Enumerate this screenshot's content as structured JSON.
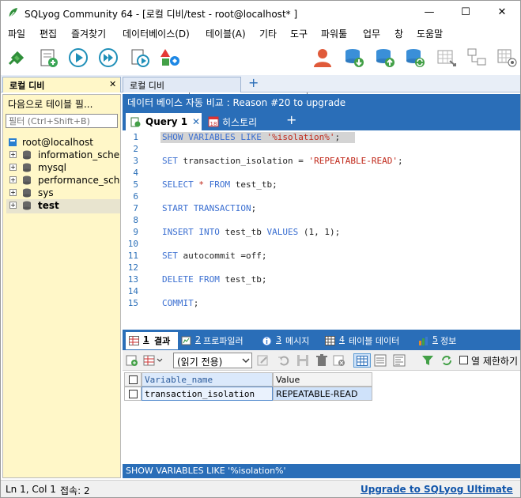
{
  "window": {
    "title": "SQLyog Community 64 - [로컬 디비/test - root@localhost* ]",
    "minimize": "—",
    "maximize": "☐",
    "close": "✕"
  },
  "menu": [
    "파일",
    "편집",
    "즐겨찾기",
    "데이터베이스(D)",
    "테이블(A)",
    "기타",
    "도구",
    "파워툴",
    "업무",
    "창",
    "도움말"
  ],
  "toolbar": {
    "database_select": "test"
  },
  "connection_tabs": [
    {
      "label": "로컬 디비",
      "close": "✕",
      "active": true
    },
    {
      "label": "로컬 디비",
      "active": false
    }
  ],
  "add_tab": "+",
  "object_browser": {
    "header": "다음으로 테이블 필...",
    "filter_placeholder": "필터 (Ctrl+Shift+B)",
    "root": "root@localhost",
    "databases": [
      {
        "name": "information_schema",
        "bold": false
      },
      {
        "name": "mysql",
        "bold": false
      },
      {
        "name": "performance_schema",
        "bold": false
      },
      {
        "name": "sys",
        "bold": false
      },
      {
        "name": "test",
        "bold": true
      }
    ]
  },
  "notice": "데이터 베이스 자동 비교 : Reason #20 to upgrade",
  "query_tabs": [
    {
      "label": "Query 1",
      "close": "✕",
      "active": true
    },
    {
      "label": "히스토리",
      "active": false
    }
  ],
  "add_query_tab": "+",
  "editor": {
    "lines": [
      {
        "num": "1",
        "parts": [
          {
            "t": "SHOW VARIABLES LIKE ",
            "c": "kw"
          },
          {
            "t": "'%isolation%'",
            "c": "str"
          },
          {
            "t": ";",
            "c": "plain"
          }
        ]
      },
      {
        "num": "2",
        "parts": []
      },
      {
        "num": "3",
        "parts": [
          {
            "t": "SET ",
            "c": "kw"
          },
          {
            "t": "transaction_isolation = ",
            "c": "plain"
          },
          {
            "t": "'REPEATABLE-READ'",
            "c": "str"
          },
          {
            "t": ";",
            "c": "plain"
          }
        ]
      },
      {
        "num": "4",
        "parts": []
      },
      {
        "num": "5",
        "parts": [
          {
            "t": "SELECT ",
            "c": "kw"
          },
          {
            "t": "* ",
            "c": "str"
          },
          {
            "t": "FROM ",
            "c": "kw"
          },
          {
            "t": "test_tb;",
            "c": "plain"
          }
        ]
      },
      {
        "num": "6",
        "parts": []
      },
      {
        "num": "7",
        "parts": [
          {
            "t": "START TRANSACTION",
            "c": "kw"
          },
          {
            "t": ";",
            "c": "plain"
          }
        ]
      },
      {
        "num": "8",
        "parts": []
      },
      {
        "num": "9",
        "parts": [
          {
            "t": "INSERT INTO ",
            "c": "kw"
          },
          {
            "t": "test_tb ",
            "c": "plain"
          },
          {
            "t": "VALUES ",
            "c": "kw"
          },
          {
            "t": "(1, 1);",
            "c": "plain"
          }
        ]
      },
      {
        "num": "10",
        "parts": []
      },
      {
        "num": "11",
        "parts": [
          {
            "t": "SET ",
            "c": "kw"
          },
          {
            "t": "autocommit =off;",
            "c": "plain"
          }
        ]
      },
      {
        "num": "12",
        "parts": []
      },
      {
        "num": "13",
        "parts": [
          {
            "t": "DELETE FROM ",
            "c": "kw"
          },
          {
            "t": "test_tb;",
            "c": "plain"
          }
        ]
      },
      {
        "num": "14",
        "parts": []
      },
      {
        "num": "15",
        "parts": [
          {
            "t": "COMMIT",
            "c": "kw"
          },
          {
            "t": ";",
            "c": "plain"
          }
        ]
      }
    ]
  },
  "result_tabs": [
    {
      "num": "1",
      "label": "결과",
      "active": true
    },
    {
      "num": "2",
      "label": "프로파일러"
    },
    {
      "num": "3",
      "label": "메시지"
    },
    {
      "num": "4",
      "label": "테이블 데이터"
    },
    {
      "num": "5",
      "label": "정보"
    }
  ],
  "result_toolbar": {
    "mode": "(읽기 전용)",
    "limit_label": "열 제한하기"
  },
  "grid": {
    "columns": [
      "Variable_name",
      "Value"
    ],
    "rows": [
      [
        "transaction_isolation",
        "REPEATABLE-READ"
      ]
    ]
  },
  "sql_status": "SHOW VARIABLES LIKE '%isolation%'",
  "status": {
    "position": "Ln 1, Col 1",
    "connections": "접속: 2",
    "upgrade_link": "Upgrade to SQLyog Ultimate"
  },
  "colors": {
    "accent_blue": "#2a6eb8",
    "browser_bg": "#fff7c8",
    "keyword": "#3b6fd1",
    "string": "#c0281a",
    "link": "#1155aa"
  }
}
